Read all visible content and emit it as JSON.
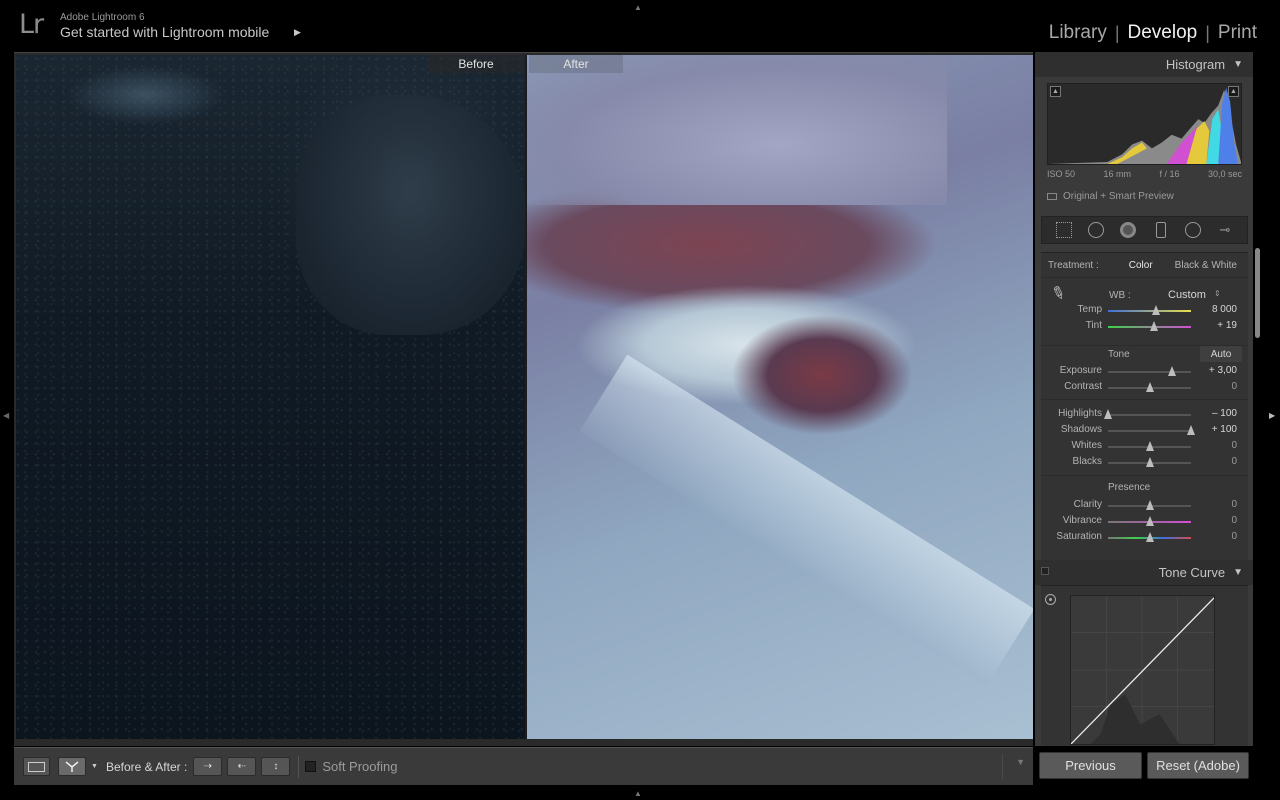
{
  "top": {
    "logo": "Lr",
    "app_version": "Adobe Lightroom 6",
    "mobile_link": "Get started with Lightroom mobile",
    "modules": [
      "Library",
      "Develop",
      "Print"
    ],
    "active_module": "Develop"
  },
  "view": {
    "before_label": "Before",
    "after_label": "After"
  },
  "toolbar": {
    "before_after_label": "Before & After :",
    "soft_proofing_label": "Soft Proofing",
    "soft_proofing_checked": false
  },
  "histogram": {
    "title": "Histogram",
    "iso": "ISO 50",
    "focal": "16 mm",
    "aperture": "f / 16",
    "shutter": "30,0 sec",
    "preview_status": "Original + Smart Preview"
  },
  "basic": {
    "treatment_label": "Treatment :",
    "treatment_color": "Color",
    "treatment_bw": "Black & White",
    "wb_label": "WB :",
    "wb_value": "Custom",
    "temp": {
      "label": "Temp",
      "value": "8 000",
      "pos": 0.58
    },
    "tint": {
      "label": "Tint",
      "value": "+ 19",
      "pos": 0.56
    },
    "tone_title": "Tone",
    "auto_label": "Auto",
    "exposure": {
      "label": "Exposure",
      "value": "+ 3,00",
      "pos": 0.77
    },
    "contrast": {
      "label": "Contrast",
      "value": "0",
      "pos": 0.5
    },
    "highlights": {
      "label": "Highlights",
      "value": "– 100",
      "pos": 0.0
    },
    "shadows": {
      "label": "Shadows",
      "value": "+ 100",
      "pos": 1.0
    },
    "whites": {
      "label": "Whites",
      "value": "0",
      "pos": 0.5
    },
    "blacks": {
      "label": "Blacks",
      "value": "0",
      "pos": 0.5
    },
    "presence_title": "Presence",
    "clarity": {
      "label": "Clarity",
      "value": "0",
      "pos": 0.5
    },
    "vibrance": {
      "label": "Vibrance",
      "value": "0",
      "pos": 0.5
    },
    "saturation": {
      "label": "Saturation",
      "value": "0",
      "pos": 0.5
    }
  },
  "tone_curve": {
    "title": "Tone Curve"
  },
  "buttons": {
    "previous": "Previous",
    "reset": "Reset (Adobe)"
  },
  "colors": {
    "background": "#000000",
    "panel": "#3a3a3a",
    "active_text": "#f0f0f0"
  }
}
